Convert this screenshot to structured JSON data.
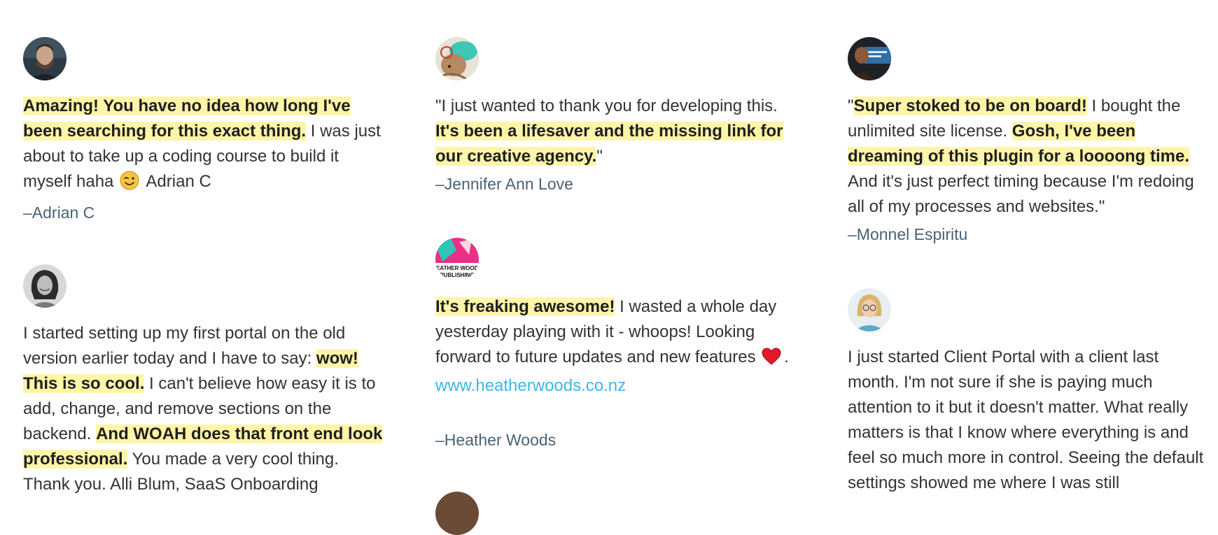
{
  "testimonials": {
    "col1": [
      {
        "avatar_icon": "avatar-man-beard-icon",
        "hl1": "Amazing! You have no idea how long I've been searching for this exact thing.",
        "t1": " I was just about to take up a coding course to build it myself haha ",
        "emoji_icon": "winking-face-emoji",
        "t2": " Adrian C",
        "author": "–Adrian C"
      },
      {
        "avatar_icon": "avatar-woman-smiling-icon",
        "t1": "I started setting up my first portal on the old version earlier today and I have to say: ",
        "hl1": "wow! This is so cool.",
        "t2": " I can't believe how easy it is to add, change, and remove sections on the backend. ",
        "hl2": "And WOAH does that front end look professional.",
        "t3": " You made a very cool thing. Thank you. Alli Blum, SaaS Onboarding"
      }
    ],
    "col2": [
      {
        "avatar_icon": "avatar-dog-hat-icon",
        "t1": "\"I just wanted to thank you for developing this. ",
        "hl1": "It's been a lifesaver and the missing link for our creative agency.",
        "t2": "\"",
        "author": "–Jennifer Ann Love"
      },
      {
        "avatar_icon": "heather-woods-publishing-logo",
        "logo_text_1": "HEATHER WOODS",
        "logo_text_2": "PUBLISHING",
        "hl1": "It's freaking awesome!",
        "t1": " I wasted a whole day yesterday playing with it - whoops! Looking forward to future updates and new features ",
        "emoji_icon": "red-heart-emoji",
        "t2": ". ",
        "link": "www.heatherwoods.co.nz",
        "author": "–Heather Woods"
      }
    ],
    "col3": [
      {
        "avatar_icon": "avatar-man-screen-icon",
        "t1": "\"",
        "hl1": "Super stoked to be on board!",
        "t2": " I bought the unlimited site license. ",
        "hl2": "Gosh, I've been dreaming of this plugin for a loooong time.",
        "t3": " And it's just perfect timing because I'm redoing all of my processes and websites.\"",
        "author": "–Monnel Espiritu"
      },
      {
        "avatar_icon": "avatar-woman-glasses-icon",
        "t1": "I just started Client Portal with a client last month. I'm not sure if she is paying much attention to it but it doesn't matter. What really matters is that I know where everything is and feel so much more in control. Seeing the default settings showed me where I was still"
      }
    ]
  },
  "colors": {
    "highlight": "#fff5a8",
    "link": "#3db6ea",
    "author": "#4a6273",
    "text": "#333333"
  }
}
